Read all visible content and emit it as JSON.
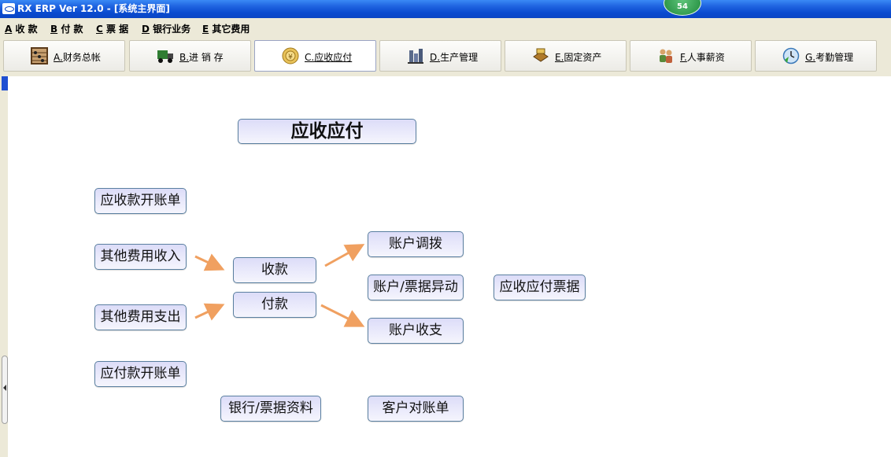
{
  "window": {
    "title": "RX ERP Ver 12.0 - [系统主界面]",
    "notification_count": "54"
  },
  "menu": [
    {
      "key": "A",
      "label": "收 款"
    },
    {
      "key": "B",
      "label": "付 款"
    },
    {
      "key": "C",
      "label": "票 据"
    },
    {
      "key": "D",
      "label": "银行业务"
    },
    {
      "key": "E",
      "label": "其它费用"
    }
  ],
  "tabs": [
    {
      "key": "A.",
      "label": "财务总帐",
      "icon": "abacus-icon"
    },
    {
      "key": "B.",
      "label": "进 销 存",
      "icon": "truck-icon"
    },
    {
      "key": "C.",
      "label": "应收应付",
      "icon": "coin-icon",
      "active": true
    },
    {
      "key": "D.",
      "label": "生产管理",
      "icon": "factory-icon"
    },
    {
      "key": "E.",
      "label": "固定资产",
      "icon": "treasure-icon"
    },
    {
      "key": "F.",
      "label": "人事薪资",
      "icon": "people-icon"
    },
    {
      "key": "G.",
      "label": "考勤管理",
      "icon": "clock-icon"
    }
  ],
  "flow": {
    "title": "应收应付",
    "receivable_invoice": "应收款开账单",
    "other_income": "其他费用收入",
    "other_expense": "其他费用支出",
    "payable_invoice": "应付款开账单",
    "receipt": "收款",
    "payment": "付款",
    "account_transfer": "账户调拨",
    "account_bill_change": "账户/票据异动",
    "account_income_expense": "账户收支",
    "ar_ap_bills": "应收应付票据",
    "bank_bill_data": "银行/票据资料",
    "customer_statement": "客户对账单"
  },
  "colors": {
    "titlebar": "#0a45c4",
    "arrow": "#f0a060",
    "button_border": "#5a7fa0",
    "button_fill": "#e9e9fb"
  }
}
